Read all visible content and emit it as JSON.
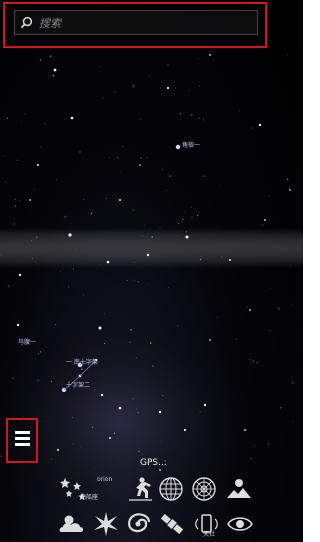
{
  "search": {
    "placeholder": "搜索"
  },
  "star_labels": {
    "jiaoxiu": "角宿一",
    "mafu": "马腹一",
    "nanmenzi": "一 南十字架",
    "shizijia": "十字架二"
  },
  "status": {
    "gps": "GPS..."
  },
  "toolbar": {
    "constellation_art_label": "orion",
    "constellations_label": "南船座",
    "satellites_label": "天社"
  },
  "icons": {
    "search": "search-icon",
    "menu": "hamburger-menu-icon",
    "constellation_art": "constellation-art-icon",
    "landscape_person": "person-landscape-icon",
    "azimuth_grid": "azimuthal-grid-icon",
    "equatorial_grid": "equatorial-grid-icon",
    "ground": "ground-landscape-icon",
    "atmosphere": "atmosphere-cloud-icon",
    "deep_sky": "deep-sky-object-icon",
    "galaxy": "galaxy-icon",
    "satellite": "satellite-icon",
    "device_sensor": "device-sensor-icon",
    "night_mode": "eye-night-mode-icon"
  },
  "colors": {
    "highlight": "#d01a1a",
    "label": "#b9c7e8",
    "sky": "#000000"
  }
}
